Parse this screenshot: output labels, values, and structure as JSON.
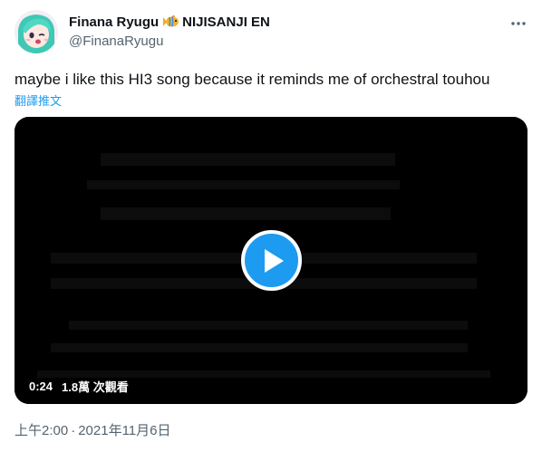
{
  "author": {
    "display_name": "Finana Ryugu",
    "affiliation": "NIJISANJI EN",
    "handle": "@FinanaRyugu",
    "badge_icon": "tropical-fish-emoji"
  },
  "tweet": {
    "text": "maybe i like this HI3 song because it reminds me of orchestral touhou",
    "translate_label": "翻譯推文"
  },
  "video": {
    "duration": "0:24",
    "views": "1.8萬 次觀看"
  },
  "meta": {
    "time": "上午2:00",
    "separator": "·",
    "date": "2021年11月6日"
  },
  "colors": {
    "accent": "#1d9bf0",
    "text_primary": "#0f1419",
    "text_secondary": "#536471"
  }
}
